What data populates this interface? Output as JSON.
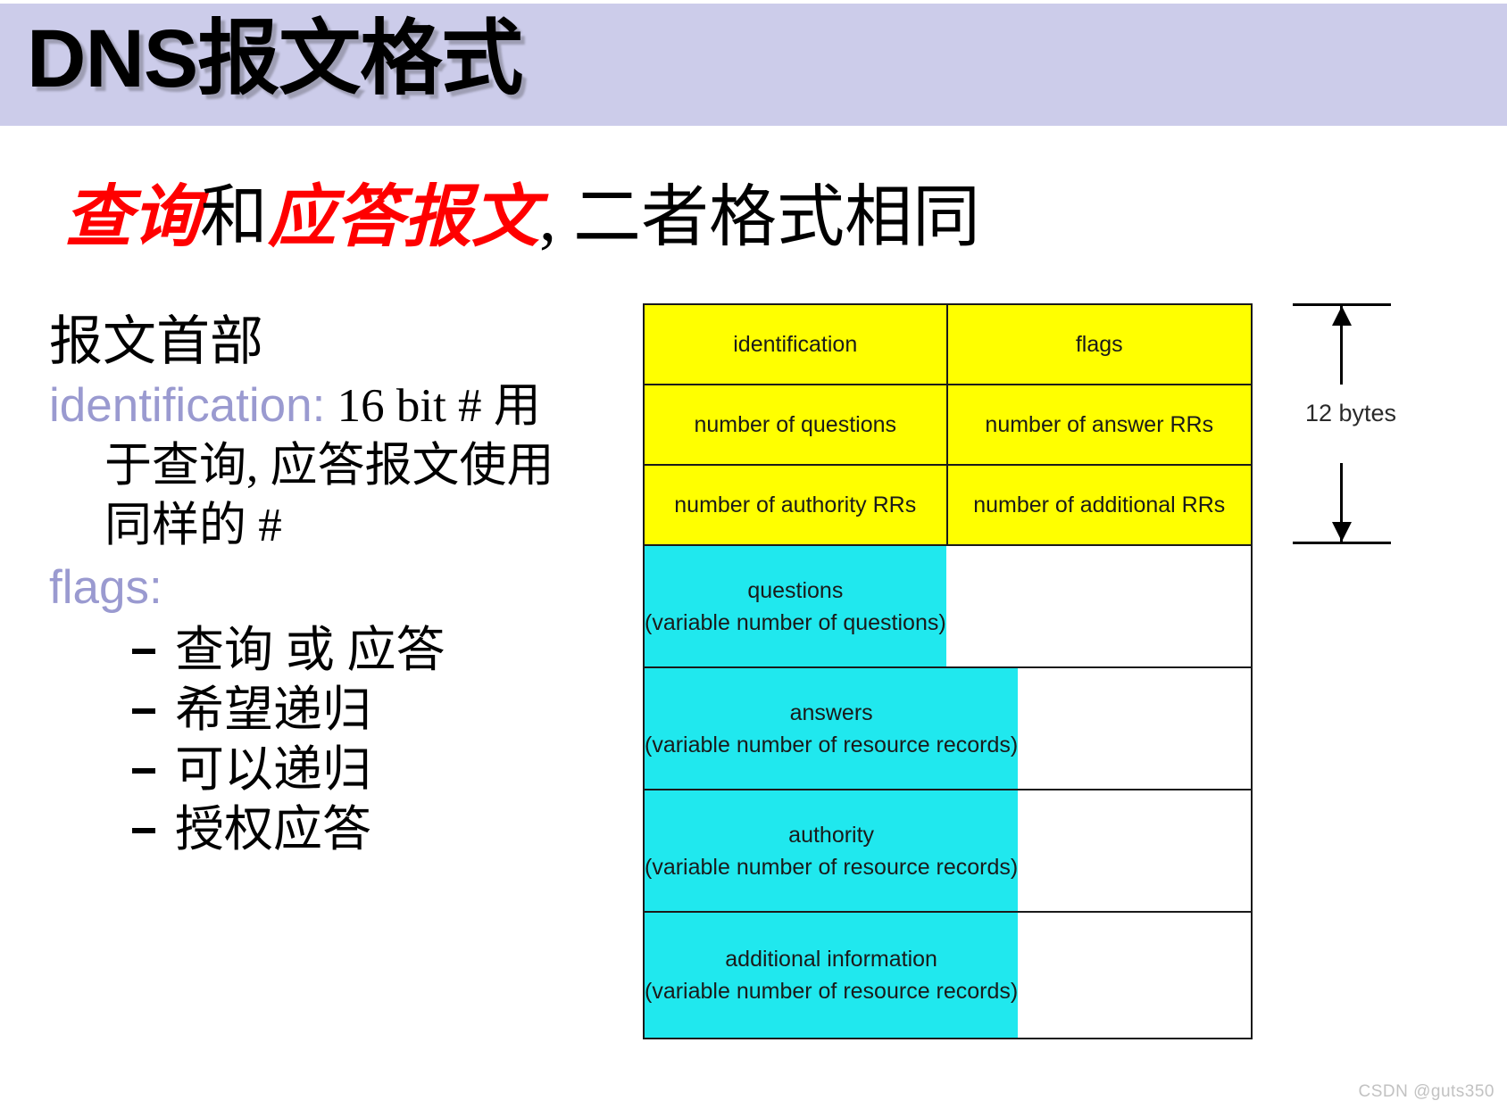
{
  "slide": {
    "title": "DNS报文格式",
    "title_band_color": "#ccccea",
    "subtitle": {
      "part1_red": "查询",
      "part2_black": "和",
      "part3_red": "应答报文",
      "part4_black": ", 二者格式相同"
    }
  },
  "body": {
    "heading": "报文首部",
    "identification": {
      "label": "identification:",
      "label_color": "#9a9ad0",
      "text": " 16 bit # 用",
      "cont_line_1": "于查询, 应答报文使用",
      "cont_line_2": "同样的 #"
    },
    "flags": {
      "label": "flags:",
      "label_color": "#9a9ad0",
      "items": [
        "查询 或 应答",
        "希望递归",
        "可以递归",
        "授权应答"
      ]
    }
  },
  "diagram": {
    "header_color": "#ffff00",
    "payload_color": "#20e8ee",
    "border_color": "#1a1a1a",
    "header_rows": [
      {
        "left": "identification",
        "right": "flags"
      },
      {
        "left": "number of questions",
        "right": "number of answer RRs"
      },
      {
        "left": "number of authority RRs",
        "right": "number of additional RRs"
      }
    ],
    "payload_rows": [
      {
        "title": "questions",
        "detail": "(variable number of questions)"
      },
      {
        "title": "answers",
        "detail": "(variable number of resource records)"
      },
      {
        "title": "authority",
        "detail": "(variable number of resource  records)"
      },
      {
        "title": "additional information",
        "detail": "(variable number of resource records)"
      }
    ],
    "dimension": {
      "label": "12 bytes"
    }
  },
  "watermark": {
    "text": "CSDN @guts350"
  }
}
